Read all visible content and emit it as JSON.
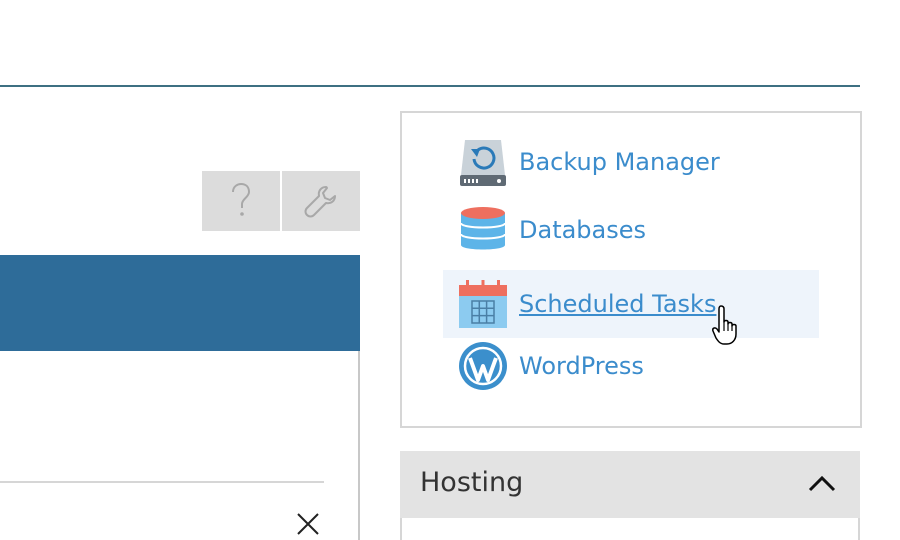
{
  "toolbar": {
    "help_icon": "question-mark-icon",
    "tools_icon": "wrench-icon"
  },
  "apps": [
    {
      "label": "Backup Manager",
      "icon": "backup-drive-icon"
    },
    {
      "label": "Databases",
      "icon": "database-icon"
    },
    {
      "label": "Scheduled Tasks",
      "icon": "calendar-icon"
    },
    {
      "label": "WordPress",
      "icon": "wordpress-icon"
    }
  ],
  "hosting": {
    "title": "Hosting",
    "expanded": true
  },
  "colors": {
    "banner": "#2e6c99",
    "link": "#3b8ccc",
    "header_rule": "#3d7082",
    "hover_bg": "#eef4fb"
  }
}
